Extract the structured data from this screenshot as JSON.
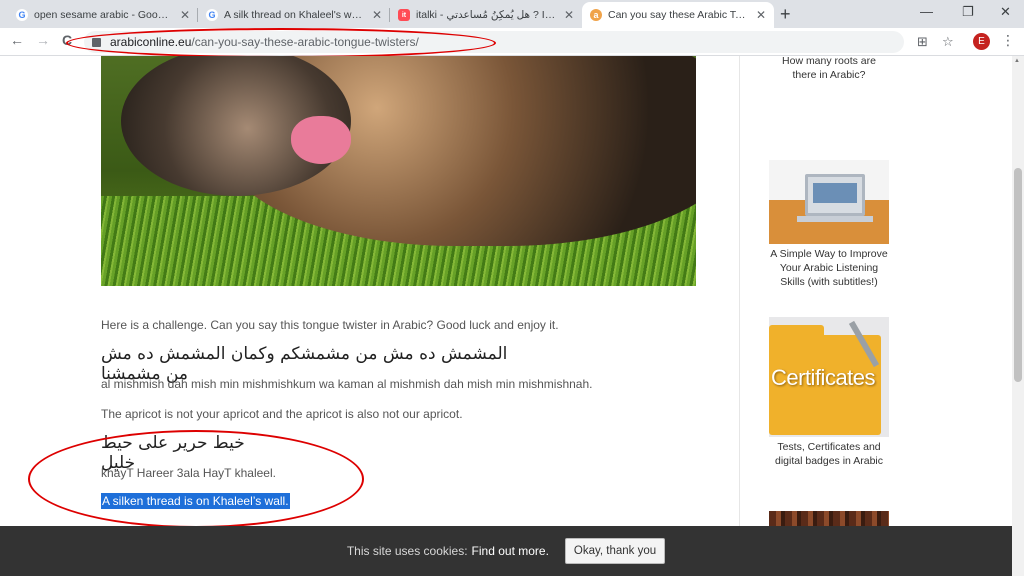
{
  "browser": {
    "tabs": [
      {
        "title": "open sesame arabic - Google Sea",
        "favicon": "google-icon"
      },
      {
        "title": "A silk thread on Khaleel's wall - G",
        "favicon": "google-icon"
      },
      {
        "title": "italki - هل يُمكِنُ مُساعدتي ? In Ara",
        "favicon": "italki-icon"
      },
      {
        "title": "Can you say these Arabic Tongue",
        "favicon": "arabiconline-icon"
      }
    ],
    "close_glyph": "✕",
    "new_tab_glyph": "+",
    "window_controls": {
      "minimize": "—",
      "restore": "❐",
      "close": "✕"
    },
    "nav": {
      "back": "←",
      "forward": "→",
      "reload": "C"
    },
    "url_host": "arabiconline.eu",
    "url_path": "/can-you-say-these-arabic-tongue-twisters/",
    "extension_glyph": "⊞",
    "bookmark_glyph": "☆",
    "profile_initial": "E",
    "menu_glyph": "⋮"
  },
  "article": {
    "intro": "Here is a challenge. Can you say this tongue twister in Arabic? Good luck and enjoy it.",
    "twister1": {
      "arabic": "المشمش ده مش من مشمشكم وكمان المشمش ده مش من مشمشنا",
      "transliteration": "al mishmish dah mish min mishmishkum wa kaman al mishmish dah mish min mishmishnah.",
      "translation": "The apricot is not your apricot and the apricot is also not our apricot."
    },
    "twister2": {
      "arabic": "خيط حرير على حيط خليل",
      "transliteration": "khayT Hareer 3ala HayT khaleel.",
      "translation": "A silken thread is on Khaleel’s wall."
    }
  },
  "sidebar": {
    "caption_top": "How many roots are there in Arabic?",
    "caption_listening": "A Simple Way to Improve Your Arabic Listening Skills (with subtitles!)",
    "cert_image_text": "Certificates",
    "caption_certificates": "Tests, Certificates and digital badges in Arabic"
  },
  "cookie": {
    "text": "This site uses cookies:",
    "link": "Find out more.",
    "button": "Okay, thank you"
  },
  "colors": {
    "annotation": "#dd0000",
    "selection": "#1e6fd9",
    "cookie_bar": "#333333"
  }
}
